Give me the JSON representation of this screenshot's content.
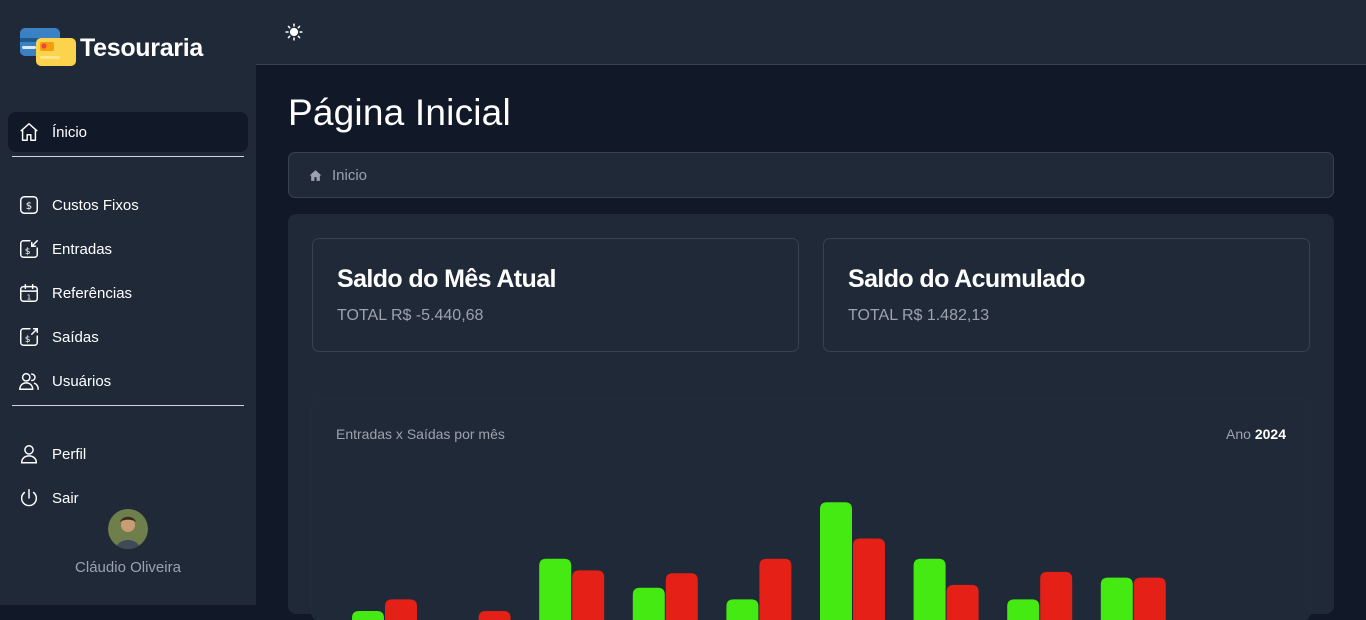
{
  "app": {
    "name": "Tesouraria"
  },
  "sidebar": {
    "items": [
      {
        "label": "Ínicio",
        "icon": "home-icon",
        "active": true
      },
      {
        "label": "Custos Fixos",
        "icon": "dollar-square-icon"
      },
      {
        "label": "Entradas",
        "icon": "money-in-icon"
      },
      {
        "label": "Referências",
        "icon": "calendar-icon"
      },
      {
        "label": "Saídas",
        "icon": "money-out-icon"
      },
      {
        "label": "Usuários",
        "icon": "users-icon"
      },
      {
        "label": "Perfil",
        "icon": "user-icon"
      },
      {
        "label": "Sair",
        "icon": "power-icon"
      }
    ],
    "user_name": "Cláudio Oliveira"
  },
  "header": {
    "theme_icon": "sun-icon"
  },
  "main": {
    "title": "Página Inicial",
    "breadcrumb": "Inicio",
    "cards": [
      {
        "title": "Saldo do Mês Atual",
        "value": "TOTAL R$ -5.440,68"
      },
      {
        "title": "Saldo do Acumulado",
        "value": "TOTAL R$ 1.482,13"
      }
    ],
    "chart": {
      "title": "Entradas x Saídas por mês",
      "year_label": "Ano",
      "year": "2024"
    }
  },
  "colors": {
    "entradas": "#44ea12",
    "saidas": "#e52016",
    "sidebar_bg": "#1f2937",
    "page_bg": "#111827"
  },
  "chart_data": {
    "type": "bar",
    "categories": [
      "",
      "",
      "",
      "",
      "",
      "",
      "",
      "",
      ""
    ],
    "series": [
      {
        "values": [
          20,
          0,
          56,
          36,
          28,
          95,
          56,
          28,
          43
        ]
      },
      {
        "values": [
          28,
          20,
          48,
          46,
          56,
          70,
          38,
          47,
          43
        ]
      }
    ]
  }
}
